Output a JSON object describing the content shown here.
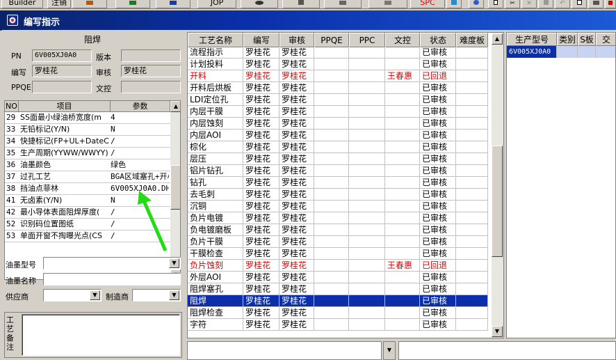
{
  "toolbar": {
    "builder_label": "Builder",
    "zhuxiao_label": "注销",
    "jop_label": "JOP",
    "spc_label": "SPC"
  },
  "window": {
    "title": "编写指示"
  },
  "left": {
    "section_title": "阻焊",
    "pn_label": "PN",
    "pn_value": "6V005XJ0A0",
    "version_label": "版本",
    "version_value": "",
    "writer_label": "编写",
    "writer_value": "罗桂花",
    "reviewer_label": "审核",
    "reviewer_value": "罗桂花",
    "ppqe_label": "PPQE",
    "ppqe_value": "",
    "doc_control_label": "文控",
    "doc_control_value": "",
    "param_table": {
      "headers": [
        "NO",
        "项目",
        "参数"
      ],
      "rows": [
        {
          "no": "29",
          "item": "SS面最小绿油桥宽度(m",
          "value": "4"
        },
        {
          "no": "33",
          "item": "无铅标记(Y/N)",
          "value": "N"
        },
        {
          "no": "34",
          "item": "快捷标记(FP+UL+DateCo",
          "value": "/"
        },
        {
          "no": "35",
          "item": "生产周期(YYWW/WWYY)",
          "value": "/"
        },
        {
          "no": "36",
          "item": "油墨颜色",
          "value": "绿色"
        },
        {
          "no": "37",
          "item": "过孔工艺",
          "value": "BGA区域塞孔+开小"
        },
        {
          "no": "38",
          "item": "挡油点菲林",
          "value": "6V005XJ0A0.DH"
        },
        {
          "no": "41",
          "item": "无卤素(Y/N)",
          "value": "N"
        },
        {
          "no": "42",
          "item": "最小导体表面阻焊厚度(",
          "value": "/"
        },
        {
          "no": "52",
          "item": "识别码位置图纸",
          "value": "/"
        },
        {
          "no": "53",
          "item": "单面开窗不掏曝光点(CS",
          "value": "/"
        }
      ]
    },
    "ink_model_label": "油墨型号",
    "ink_model_value": "",
    "ink_name_label": "油墨名称",
    "ink_name_value": "",
    "supplier_label": "供应商",
    "supplier_value": "",
    "manufacturer_label": "制造商",
    "manufacturer_value": "",
    "remark_label": "工艺备注",
    "remark_value": ""
  },
  "grid": {
    "headers": [
      "工艺名称",
      "编写",
      "审核",
      "PPQE",
      "PPC",
      "文控",
      "状态",
      "难度板"
    ],
    "rows": [
      {
        "name": "流程指示",
        "writer": "罗桂花",
        "reviewer": "罗桂花",
        "ppqe": "",
        "ppc": "",
        "doc": "",
        "status": "已审核",
        "style": "normal"
      },
      {
        "name": "计划投料",
        "writer": "罗桂花",
        "reviewer": "罗桂花",
        "ppqe": "",
        "ppc": "",
        "doc": "",
        "status": "已审核",
        "style": "normal"
      },
      {
        "name": "开料",
        "writer": "罗桂花",
        "reviewer": "罗桂花",
        "ppqe": "",
        "ppc": "",
        "doc": "王春惠",
        "status": "已回退",
        "style": "red"
      },
      {
        "name": "开料后烘板",
        "writer": "罗桂花",
        "reviewer": "罗桂花",
        "ppqe": "",
        "ppc": "",
        "doc": "",
        "status": "已审核",
        "style": "normal"
      },
      {
        "name": "LDI定位孔",
        "writer": "罗桂花",
        "reviewer": "罗桂花",
        "ppqe": "",
        "ppc": "",
        "doc": "",
        "status": "已审核",
        "style": "normal"
      },
      {
        "name": "内层干膜",
        "writer": "罗桂花",
        "reviewer": "罗桂花",
        "ppqe": "",
        "ppc": "",
        "doc": "",
        "status": "已审核",
        "style": "normal"
      },
      {
        "name": "内层蚀刻",
        "writer": "罗桂花",
        "reviewer": "罗桂花",
        "ppqe": "",
        "ppc": "",
        "doc": "",
        "status": "已审核",
        "style": "normal"
      },
      {
        "name": "内层AOI",
        "writer": "罗桂花",
        "reviewer": "罗桂花",
        "ppqe": "",
        "ppc": "",
        "doc": "",
        "status": "已审核",
        "style": "normal"
      },
      {
        "name": "棕化",
        "writer": "罗桂花",
        "reviewer": "罗桂花",
        "ppqe": "",
        "ppc": "",
        "doc": "",
        "status": "已审核",
        "style": "normal"
      },
      {
        "name": "层压",
        "writer": "罗桂花",
        "reviewer": "罗桂花",
        "ppqe": "",
        "ppc": "",
        "doc": "",
        "status": "已审核",
        "style": "normal"
      },
      {
        "name": "铝片钻孔",
        "writer": "罗桂花",
        "reviewer": "罗桂花",
        "ppqe": "",
        "ppc": "",
        "doc": "",
        "status": "已审核",
        "style": "normal"
      },
      {
        "name": "钻孔",
        "writer": "罗桂花",
        "reviewer": "罗桂花",
        "ppqe": "",
        "ppc": "",
        "doc": "",
        "status": "已审核",
        "style": "normal"
      },
      {
        "name": "去毛刺",
        "writer": "罗桂花",
        "reviewer": "罗桂花",
        "ppqe": "",
        "ppc": "",
        "doc": "",
        "status": "已审核",
        "style": "normal"
      },
      {
        "name": "沉铜",
        "writer": "罗桂花",
        "reviewer": "罗桂花",
        "ppqe": "",
        "ppc": "",
        "doc": "",
        "status": "已审核",
        "style": "normal"
      },
      {
        "name": "负片电镀",
        "writer": "罗桂花",
        "reviewer": "罗桂花",
        "ppqe": "",
        "ppc": "",
        "doc": "",
        "status": "已审核",
        "style": "normal"
      },
      {
        "name": "负电镀磨板",
        "writer": "罗桂花",
        "reviewer": "罗桂花",
        "ppqe": "",
        "ppc": "",
        "doc": "",
        "status": "已审核",
        "style": "normal"
      },
      {
        "name": "负片干膜",
        "writer": "罗桂花",
        "reviewer": "罗桂花",
        "ppqe": "",
        "ppc": "",
        "doc": "",
        "status": "已审核",
        "style": "normal"
      },
      {
        "name": "干膜检查",
        "writer": "罗桂花",
        "reviewer": "罗桂花",
        "ppqe": "",
        "ppc": "",
        "doc": "",
        "status": "已审核",
        "style": "normal"
      },
      {
        "name": "负片蚀刻",
        "writer": "罗桂花",
        "reviewer": "罗桂花",
        "ppqe": "",
        "ppc": "",
        "doc": "王春惠",
        "status": "已回退",
        "style": "red"
      },
      {
        "name": "外层AOI",
        "writer": "罗桂花",
        "reviewer": "罗桂花",
        "ppqe": "",
        "ppc": "",
        "doc": "",
        "status": "已审核",
        "style": "normal"
      },
      {
        "name": "阻焊塞孔",
        "writer": "罗桂花",
        "reviewer": "罗桂花",
        "ppqe": "",
        "ppc": "",
        "doc": "",
        "status": "已审核",
        "style": "normal"
      },
      {
        "name": "阻焊",
        "writer": "罗桂花",
        "reviewer": "罗桂花",
        "ppqe": "",
        "ppc": "",
        "doc": "",
        "status": "已审核",
        "style": "selected"
      },
      {
        "name": "阻焊检查",
        "writer": "罗桂花",
        "reviewer": "罗桂花",
        "ppqe": "",
        "ppc": "",
        "doc": "",
        "status": "已审核",
        "style": "normal"
      },
      {
        "name": "字符",
        "writer": "罗桂花",
        "reviewer": "罗桂花",
        "ppqe": "",
        "ppc": "",
        "doc": "",
        "status": "已审核",
        "style": "normal"
      }
    ]
  },
  "right_grid": {
    "headers": [
      "生产型号",
      "类别",
      "S板",
      "交"
    ],
    "rows": [
      {
        "model": "6V005XJ0A0",
        "category": "",
        "s_board": "",
        "extra": ""
      }
    ]
  },
  "colors": {
    "window_bg": "#d4d0c8",
    "title_bar": "#0a246a",
    "selection": "#0a2fa8",
    "rollback_text": "#e00000",
    "arrow": "#22dd11"
  },
  "icons": [
    "window-app-icon",
    "dropdown-arrow-icon",
    "scroll-up-icon",
    "scroll-down-icon",
    "annotation-arrow-icon",
    "mouse-cursor-icon"
  ]
}
